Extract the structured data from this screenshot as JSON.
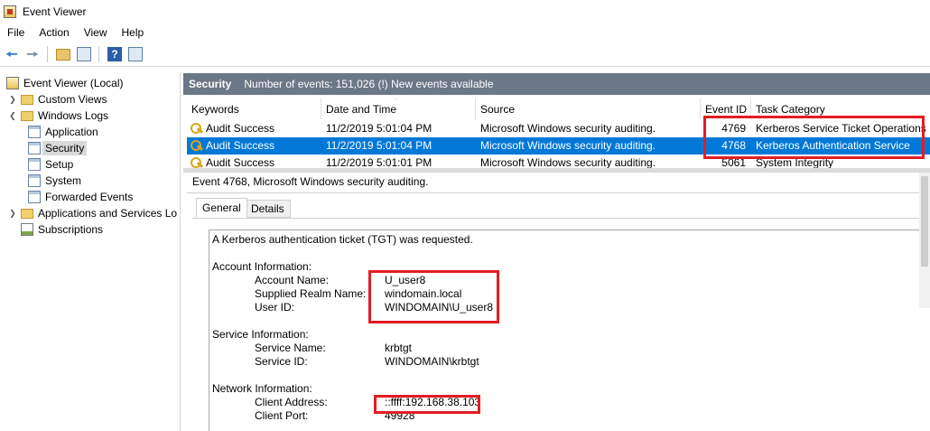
{
  "window": {
    "title": "Event Viewer"
  },
  "menu": [
    "File",
    "Action",
    "View",
    "Help"
  ],
  "toolbar": {
    "icons": [
      "back-arrow-icon",
      "forward-arrow-icon",
      "up-folder-icon",
      "show-hide-tree-icon",
      "help-icon",
      "properties-icon"
    ]
  },
  "tree": {
    "root": "Event Viewer (Local)",
    "custom_views": "Custom Views",
    "windows_logs": "Windows Logs",
    "application": "Application",
    "security": "Security",
    "setup": "Setup",
    "system": "System",
    "forwarded": "Forwarded Events",
    "app_services": "Applications and Services Lo",
    "subscriptions": "Subscriptions"
  },
  "header": {
    "title": "Security",
    "status": "Number of events: 151,026 (!) New events available"
  },
  "grid": {
    "columns": [
      "Keywords",
      "Date and Time",
      "Source",
      "Event ID",
      "Task Category"
    ],
    "rows": [
      {
        "keyword": "Audit Success",
        "date": "11/2/2019 5:01:04 PM",
        "source": "Microsoft Windows security auditing.",
        "id": "4769",
        "category": "Kerberos Service Ticket Operations"
      },
      {
        "keyword": "Audit Success",
        "date": "11/2/2019 5:01:04 PM",
        "source": "Microsoft Windows security auditing.",
        "id": "4768",
        "category": "Kerberos Authentication Service"
      },
      {
        "keyword": "Audit Success",
        "date": "11/2/2019 5:01:01 PM",
        "source": "Microsoft Windows security auditing.",
        "id": "5061",
        "category": "System Integrity"
      }
    ]
  },
  "detail": {
    "title": "Event 4768, Microsoft Windows security auditing.",
    "tabs": [
      "General",
      "Details"
    ],
    "summary": "A Kerberos authentication ticket (TGT) was requested.",
    "account_section": "Account Information:",
    "account_name_label": "Account Name:",
    "account_name": "U_user8",
    "realm_label": "Supplied Realm Name:",
    "realm": "windomain.local",
    "user_id_label": "User ID:",
    "user_id": "WINDOMAIN\\U_user8",
    "service_section": "Service Information:",
    "service_name_label": "Service Name:",
    "service_name": "krbtgt",
    "service_id_label": "Service ID:",
    "service_id": "WINDOMAIN\\krbtgt",
    "network_section": "Network Information:",
    "client_address_label": "Client Address:",
    "client_address": "::ffff:192.168.38.103",
    "client_port_label": "Client Port:",
    "client_port": "49928"
  },
  "colors": {
    "header_band": "#6b7888",
    "selection": "#0078d7",
    "highlight": "#e31d24"
  }
}
